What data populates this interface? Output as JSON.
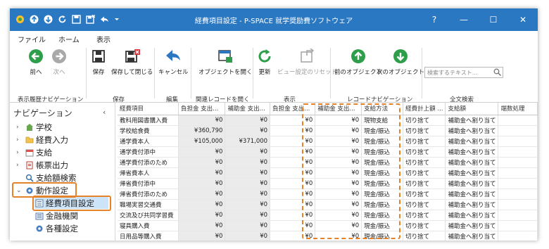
{
  "title": "経費項目設定 - P-SPACE 就学奨励費ソフトウェア",
  "window_controls": [
    "?",
    "—",
    "☐",
    "✕"
  ],
  "tabs": [
    "ファイル",
    "ホーム",
    "表示"
  ],
  "active_tab": "ホーム",
  "ribbon": {
    "back": "前へ",
    "forward": "次へ",
    "history_group": "表示履歴ナビゲーション",
    "save": "保存",
    "save_close": "保存して閉じる",
    "save_group": "保存",
    "cancel": "キャンセル",
    "edit_group": "編集",
    "open_object": "オブジェクトを開く",
    "related_group": "関連レコードを開く",
    "refresh": "更新",
    "view_reset": "ビュー設定のリセット",
    "view_group": "表示",
    "prev_object": "前のオブジェクト",
    "next_object": "次のオブジェクト",
    "record_nav_group": "レコードナビゲーション",
    "search_placeholder": "検索するテキスト...",
    "search_group": "全文検索"
  },
  "nav": {
    "title": "ナビゲーション",
    "collapse": "‹",
    "items": [
      {
        "label": "学校",
        "icon": "school-icon",
        "expander": "›"
      },
      {
        "label": "経費入力",
        "icon": "folder-icon",
        "expander": "›"
      },
      {
        "label": "支給",
        "icon": "calendar-icon",
        "expander": "›"
      },
      {
        "label": "帳票出力",
        "icon": "report-icon",
        "expander": "›"
      },
      {
        "label": "支給額検索",
        "icon": "search-icon",
        "expander": ""
      },
      {
        "label": "動作設定",
        "icon": "gear-icon",
        "expander": "⌄"
      },
      {
        "label": "経費項目設定",
        "icon": "list-icon",
        "expander": ""
      },
      {
        "label": "金融機関",
        "icon": "bank-icon",
        "expander": ""
      },
      {
        "label": "各種設定",
        "icon": "gear-icon",
        "expander": ""
      }
    ]
  },
  "grid": {
    "columns": [
      "経費項目",
      "負担金 支出...",
      "補助金 支出...",
      "負担金 支出...",
      "補助金 支出...",
      "支給方法",
      "経費計上額 ...",
      "支給額",
      "端数処理"
    ],
    "rows": [
      [
        "教科用図書購入費",
        "¥0",
        "¥0",
        "¥0",
        "¥0",
        "現物支給",
        "切り捨て",
        "補助金へ割り当て"
      ],
      [
        "学校給食費",
        "¥360,790",
        "¥0",
        "¥0",
        "¥0",
        "現金/振込",
        "切り捨て",
        "補助金へ割り当て"
      ],
      [
        "通学費本人",
        "¥105,000",
        "¥371,000",
        "¥0",
        "¥0",
        "現金/振込",
        "切り捨て",
        "補助金へ割り当て"
      ],
      [
        "通学費付添中",
        "¥0",
        "¥0",
        "¥0",
        "¥0",
        "現金/振込",
        "切り捨て",
        "補助金へ割り当て"
      ],
      [
        "通学費付添のため",
        "¥0",
        "¥0",
        "¥0",
        "¥0",
        "現金/振込",
        "切り捨て",
        "補助金へ割り当て"
      ],
      [
        "帰省費本人",
        "¥0",
        "¥0",
        "¥0",
        "¥0",
        "現金/振込",
        "切り捨て",
        "補助金へ割り当て"
      ],
      [
        "帰省費付添中",
        "¥0",
        "¥0",
        "¥0",
        "¥0",
        "現金/振込",
        "切り捨て",
        "補助金へ割り当て"
      ],
      [
        "帰省費付添のため",
        "¥0",
        "¥0",
        "¥0",
        "¥0",
        "現金/振込",
        "切り捨て",
        "補助金へ割り当て"
      ],
      [
        "職場実習交通費",
        "¥0",
        "¥0",
        "¥0",
        "¥0",
        "現金/振込",
        "切り捨て",
        "補助金へ割り当て"
      ],
      [
        "交流及び共同学習費",
        "¥0",
        "¥0",
        "¥0",
        "¥0",
        "現金/振込",
        "切り捨て",
        "補助金へ割り当て"
      ],
      [
        "寝具購入費",
        "¥0",
        "¥0",
        "¥0",
        "¥0",
        "現金/振込",
        "切り捨て",
        "補助金へ割り当て"
      ],
      [
        "日用品等購入費",
        "¥0",
        "¥0",
        "¥0",
        "¥0",
        "現金/振込",
        "切り捨て",
        "補助金へ割り当て"
      ]
    ]
  },
  "colors": {
    "titlebar": "#2b78c2",
    "highlight": "#e5832b",
    "green": "#2f9e4b",
    "gray_cell": "#ebebeb"
  }
}
